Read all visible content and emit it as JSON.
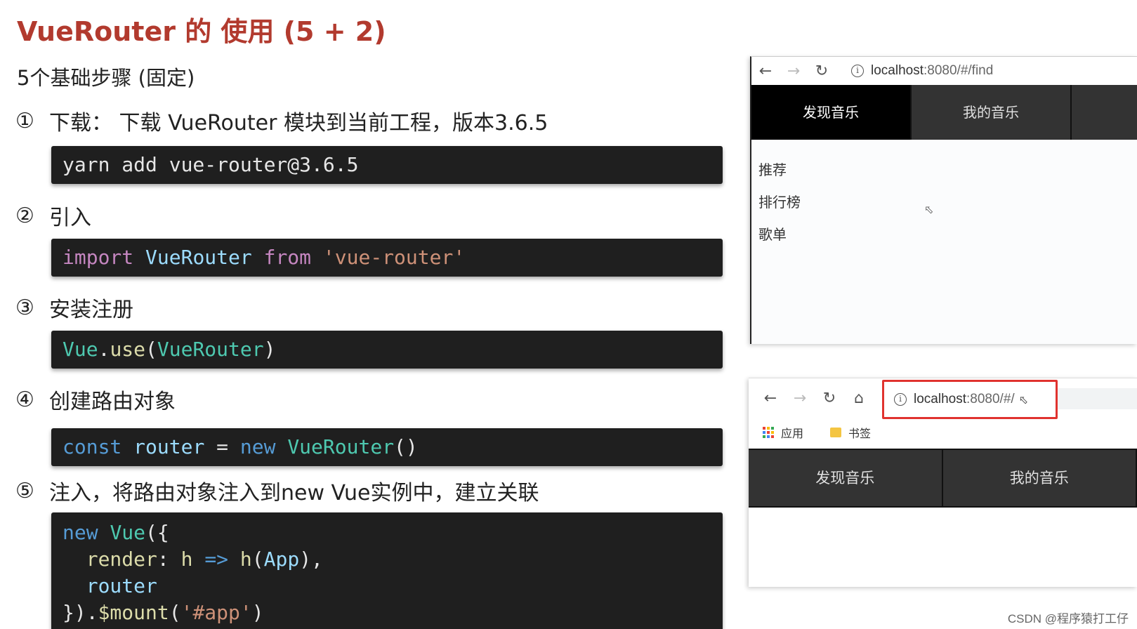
{
  "slide": {
    "title": "VueRouter 的 使用 (5 + 2)",
    "subtitle": "5个基础步骤 (固定)",
    "steps": [
      {
        "num": "①",
        "text": "下载： 下载 VueRouter 模块到当前工程，版本3.6.5"
      },
      {
        "num": "②",
        "text": "引入"
      },
      {
        "num": "③",
        "text": "安装注册"
      },
      {
        "num": "④",
        "text": "创建路由对象"
      },
      {
        "num": "⑤",
        "text": "注入，将路由对象注入到new Vue实例中，建立关联"
      }
    ],
    "code": {
      "step1": "yarn add vue-router@3.6.5",
      "step2": {
        "import": "import",
        "name": "VueRouter",
        "from": "from",
        "module": "'vue-router'"
      },
      "step3": {
        "obj": "Vue",
        "dot": ".",
        "method": "use",
        "open": "(",
        "arg": "VueRouter",
        "close": ")"
      },
      "step4": {
        "const": "const",
        "var": "router",
        "eq": " = ",
        "new": "new",
        "cls": "VueRouter",
        "parens": "()"
      },
      "step5": {
        "line1_new": "new",
        "line1_cls": "Vue",
        "line1_rest": "({",
        "line2_key": "render",
        "line2_colon": ": ",
        "line2_h": "h",
        "line2_arrow": "=>",
        "line2_call": "h",
        "line2_open": "(",
        "line2_arg": "App",
        "line2_close": "),",
        "line3": "router",
        "line4_start": "}).",
        "line4_method": "$mount",
        "line4_open": "(",
        "line4_str": "'#app'",
        "line4_close": ")"
      }
    }
  },
  "browser1": {
    "url_host": "localhost",
    "url_rest": ":8080/#/find",
    "tabs": [
      "发现音乐",
      "我的音乐"
    ],
    "active_tab": "发现音乐",
    "links": [
      "推荐",
      "排行榜",
      "歌单"
    ]
  },
  "browser2": {
    "url_host": "localhost",
    "url_rest": ":8080/#/",
    "bookmarks": {
      "apps": "应用",
      "folder": "书签"
    },
    "tabs": [
      "发现音乐",
      "我的音乐"
    ],
    "highlight_color": "#e0332f"
  },
  "watermark": "CSDN @程序猿打工仔",
  "icons": {
    "back": "arrow-left-icon",
    "forward": "arrow-right-icon",
    "reload": "reload-icon",
    "home": "home-icon",
    "info": "info-icon"
  }
}
